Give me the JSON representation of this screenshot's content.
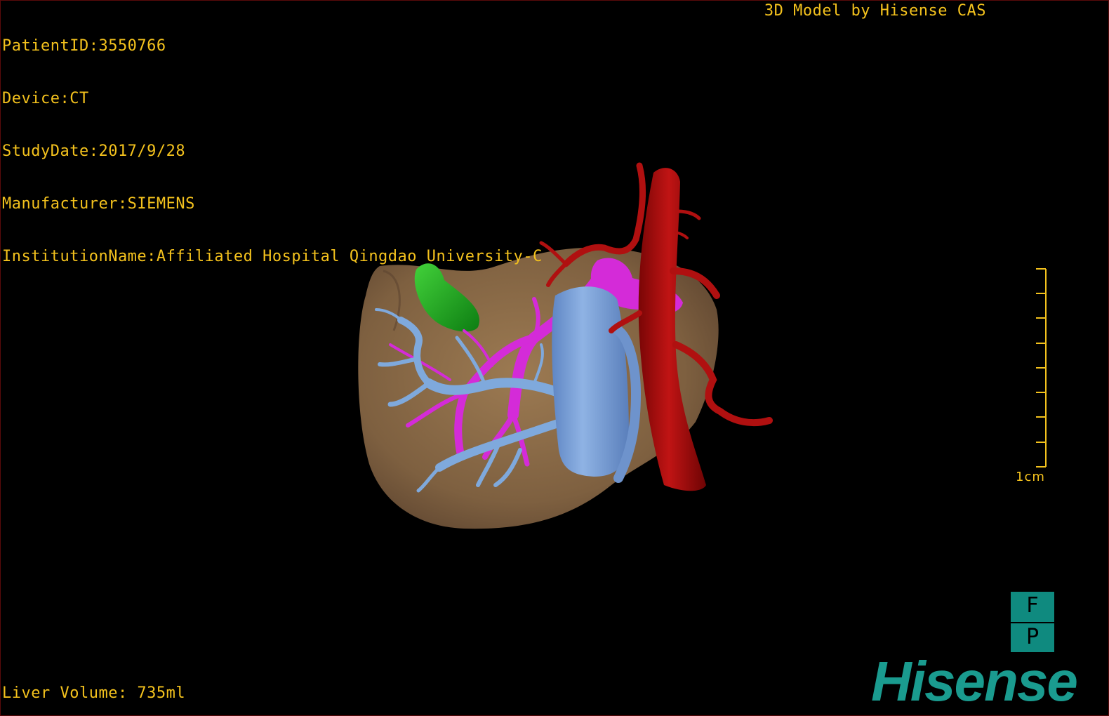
{
  "header": {
    "patient_id": "PatientID:3550766",
    "device": "Device:CT",
    "study_date": "StudyDate:2017/9/28",
    "manufacturer": "Manufacturer:SIEMENS",
    "institution": "InstitutionName:Affiliated Hospital Qingdao University-C",
    "credit": "3D Model by Hisense CAS"
  },
  "footer": {
    "liver_volume": "Liver Volume: 735ml"
  },
  "scale_bar": {
    "label": "1cm"
  },
  "orientation": {
    "top": "F",
    "bottom": "P"
  },
  "brand": {
    "logo": "Hisense"
  },
  "colors": {
    "overlay_text": "#f4c21d",
    "liver": "#8a6a45",
    "gallbladder": "#1fa81f",
    "portal_vein": "#7fa9dc",
    "hepatic_vein": "#d42bd8",
    "artery": "#b01010",
    "brand": "#1a9b8f"
  }
}
